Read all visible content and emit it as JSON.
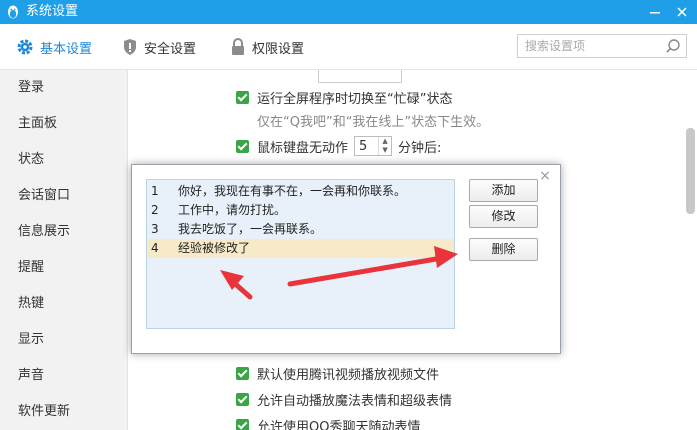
{
  "window": {
    "title": "系统设置"
  },
  "tabs": [
    {
      "label": "基本设置",
      "icon": "gear-icon",
      "active": true
    },
    {
      "label": "安全设置",
      "icon": "shield-icon",
      "active": false
    },
    {
      "label": "权限设置",
      "icon": "lock-icon",
      "active": false
    }
  ],
  "search": {
    "placeholder": "搜索设置项"
  },
  "sidebar": {
    "items": [
      {
        "label": "登录"
      },
      {
        "label": "主面板"
      },
      {
        "label": "状态"
      },
      {
        "label": "会话窗口"
      },
      {
        "label": "信息展示"
      },
      {
        "label": "提醒"
      },
      {
        "label": "热键"
      },
      {
        "label": "显示"
      },
      {
        "label": "声音"
      },
      {
        "label": "软件更新"
      }
    ]
  },
  "content": {
    "fullscreen_busy": {
      "label": "运行全屏程序时切换至“忙碌”状态",
      "checked": true
    },
    "fullscreen_hint": "仅在“Q我吧”和“我在线上”状态下生效。",
    "idle": {
      "label_before": "鼠标键盘无动作",
      "minutes": "5",
      "label_after": "分钟后:",
      "checked": true
    },
    "bottom_options": [
      {
        "label": "默认使用腾讯视频播放视频文件",
        "checked": true
      },
      {
        "label": "允许自动播放魔法表情和超级表情",
        "checked": true
      },
      {
        "label": "允许使用QQ秀聊天随动表情",
        "checked": true
      }
    ]
  },
  "dialog": {
    "close": "×",
    "replies": [
      {
        "num": "1",
        "text": "你好，我现在有事不在，一会再和你联系。"
      },
      {
        "num": "2",
        "text": "工作中，请勿打扰。"
      },
      {
        "num": "3",
        "text": "我去吃饭了，一会再联系。"
      },
      {
        "num": "4",
        "text": "经验被修改了",
        "selected": true
      }
    ],
    "buttons": {
      "add": "添加",
      "edit": "修改",
      "delete": "删除"
    }
  },
  "colors": {
    "accent": "#1e9fe8",
    "checkbox": "#3aa447",
    "arrow": "#e8343a",
    "selected_row": "#f6eac8"
  }
}
